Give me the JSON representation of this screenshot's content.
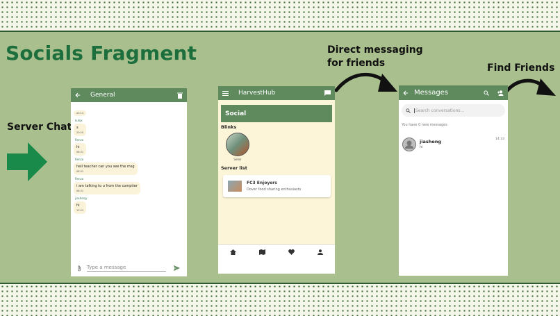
{
  "title": "Socials Fragment",
  "captions": {
    "server_chat": "Server Chat",
    "direct_line1": "Direct  messaging",
    "direct_line2": "for friends",
    "find_friends": "Find Friends"
  },
  "chat": {
    "title": "General",
    "first_time": "20:14",
    "messages": [
      {
        "name": "kuhjx",
        "text": "s",
        "time": "20:20"
      },
      {
        "name": "Renzo",
        "text": "hi",
        "time": "08:31"
      },
      {
        "name": "Renzo",
        "text": "hell teacher can you see the msg",
        "time": "08:31"
      },
      {
        "name": "Renzo",
        "text": "i am talking to u from the compiter",
        "time": "08:31"
      },
      {
        "name": "jiasheng",
        "text": "hi",
        "time": "13:23"
      }
    ],
    "input_placeholder": "Type a message"
  },
  "harvesthub": {
    "app_title": "HarvestHub",
    "section_title": "Social",
    "blinks_label": "Blinks",
    "blink_name": "Seller",
    "server_list_label": "Server list",
    "server": {
      "name": "FC3 Enjoyers",
      "desc": "Dover food sharing enthusiasts"
    }
  },
  "messages": {
    "title": "Messages",
    "search_placeholder": "Search conversations...",
    "status": "You have 0 new messages",
    "conversation": {
      "name": "jiasheng",
      "preview": "hi",
      "time": "14:33"
    }
  },
  "colors": {
    "accent": "#5e8a5e",
    "title": "#1c6e3c",
    "arrow": "#1a8a4a",
    "background": "#a9c08e"
  }
}
